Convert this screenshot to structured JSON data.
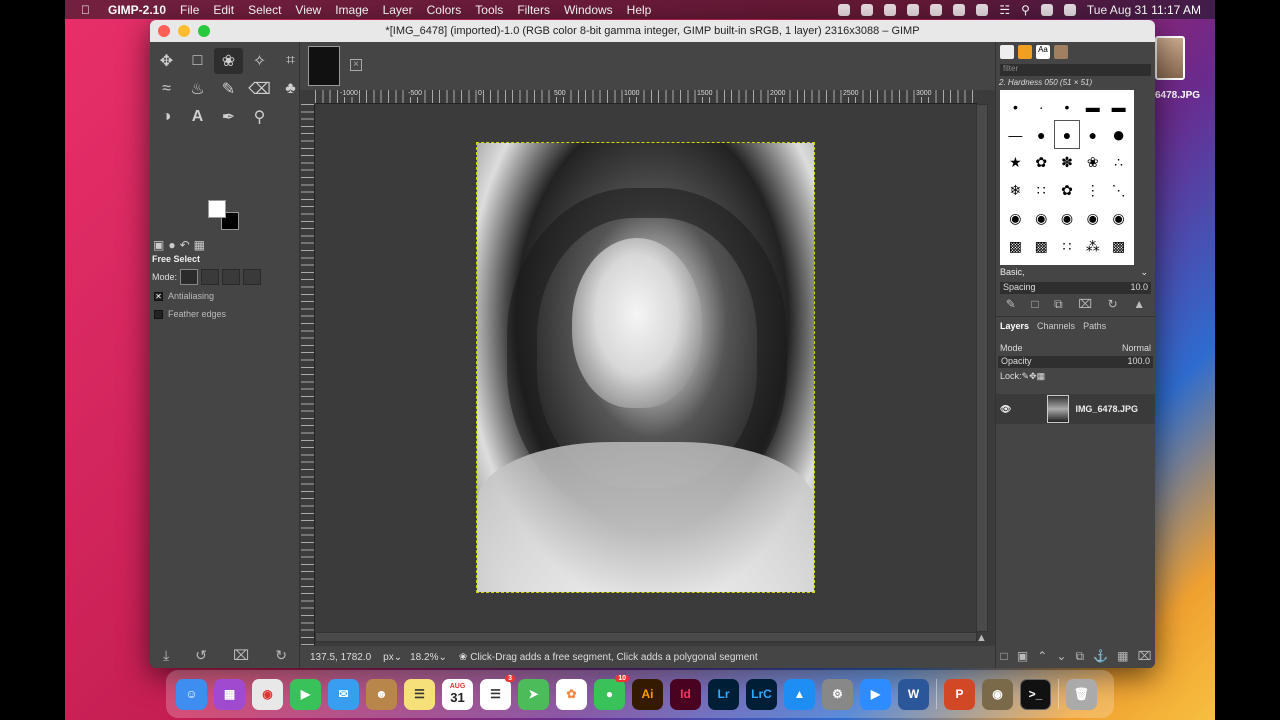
{
  "menubar": {
    "app": "GIMP-2.10",
    "items": [
      "File",
      "Edit",
      "Select",
      "View",
      "Image",
      "Layer",
      "Colors",
      "Tools",
      "Filters",
      "Windows",
      "Help"
    ],
    "clock": "Tue Aug 31  11:17 AM"
  },
  "desktop": {
    "file_label": "6478.JPG"
  },
  "window": {
    "title": "*[IMG_6478] (imported)-1.0 (RGB color 8-bit gamma integer, GIMP built-in sRGB, 1 layer) 2316x3088 – GIMP"
  },
  "tool_options": {
    "title": "Free Select",
    "mode_label": "Mode:",
    "antialiasing": "Antialiasing",
    "feather": "Feather edges"
  },
  "ruler": {
    "h_labels": [
      "-1000",
      "-500",
      "0",
      "500",
      "1000",
      "1500",
      "2000",
      "2500",
      "3000"
    ]
  },
  "status": {
    "coords": "137.5, 1782.0",
    "unit": "px",
    "zoom": "18.2%",
    "message": "Click-Drag adds a free segment, Click adds a polygonal segment"
  },
  "brushes": {
    "filter_placeholder": "filter",
    "selected": "2. Hardness 050 (51 × 51)",
    "tag": "Basic,",
    "spacing_label": "Spacing",
    "spacing_value": "10.0"
  },
  "layers": {
    "tabs": [
      "Layers",
      "Channels",
      "Paths"
    ],
    "mode_label": "Mode",
    "mode_value": "Normal",
    "opacity_label": "Opacity",
    "opacity_value": "100.0",
    "lock_label": "Lock:",
    "layer_name": "IMG_6478.JPG"
  },
  "dock": {
    "calendar_month": "AUG",
    "calendar_day": "31",
    "reminders_badge": "3",
    "messages_badge": "10",
    "apps": [
      "Ai",
      "Id",
      "Lr",
      "LrC",
      "W",
      "P"
    ]
  }
}
